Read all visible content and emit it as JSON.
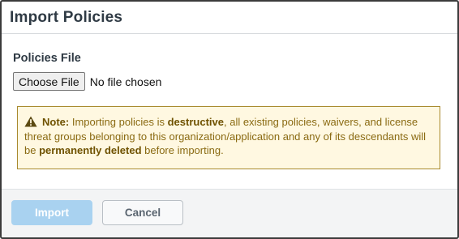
{
  "dialog": {
    "title": "Import Policies"
  },
  "form": {
    "file_label": "Policies File",
    "choose_button": "Choose File",
    "file_status": "No file chosen"
  },
  "warning": {
    "icon": "warning-triangle-icon",
    "note_label": "Note:",
    "text_1": " Importing policies is ",
    "strong_1": "destructive",
    "text_2": ", all existing policies, waivers, and license threat groups belonging to this organization/application and any of its descendants will be ",
    "strong_2": "permanently deleted",
    "text_3": " before importing."
  },
  "footer": {
    "import_label": "Import",
    "cancel_label": "Cancel"
  },
  "colors": {
    "warning_bg": "#fff8e1",
    "warning_border": "#a98a2e",
    "warning_text": "#8a6a12",
    "primary_disabled": "#a9d2f0"
  }
}
